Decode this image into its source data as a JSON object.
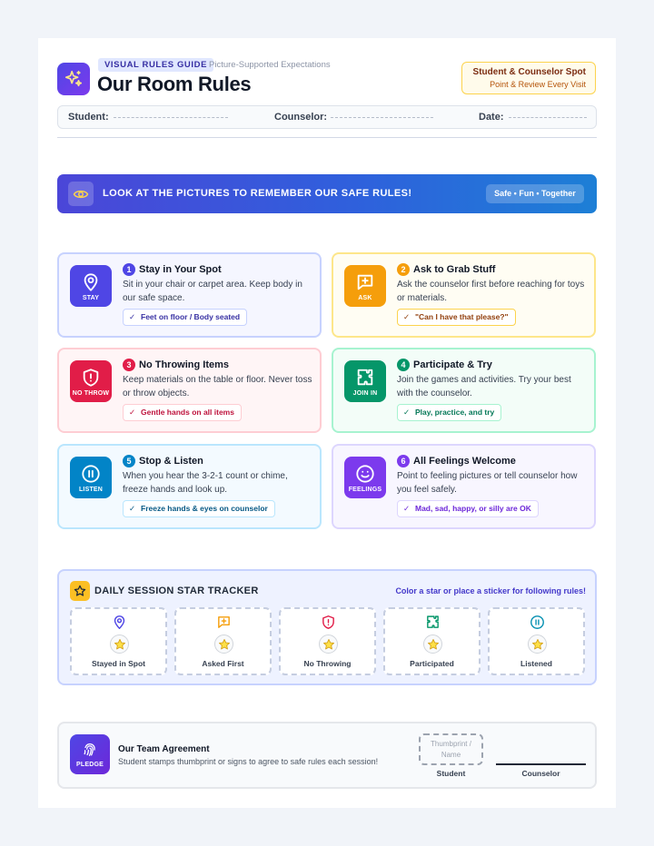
{
  "header": {
    "badge": "VISUAL RULES GUIDE",
    "subtitle": "Picture-Supported Expectations",
    "title": "Our Room Rules",
    "spot_title": "Student & Counselor Spot",
    "spot_subtitle": "Point & Review Every Visit",
    "logo_icon": "sparkles-icon"
  },
  "fields": {
    "student_label": "Student:",
    "counselor_label": "Counselor:",
    "date_label": "Date:"
  },
  "banner": {
    "icon": "eye-icon",
    "text": "LOOK AT THE PICTURES TO REMEMBER OUR SAFE RULES!",
    "tag": "Safe • Fun • Together"
  },
  "rules": [
    {
      "num": "1",
      "title": "Stay in Your Spot",
      "desc": "Sit in your chair or carpet area. Keep body in our safe space.",
      "tip": "Feet on floor / Body seated",
      "tile_label": "STAY",
      "icon": "map-pin-icon",
      "color": "#4f46e5",
      "border": "#c7d2fe",
      "bg": "#f5f6ff",
      "tip_color": "#3730a3",
      "tip_border": "#c7d2fe"
    },
    {
      "num": "2",
      "title": "Ask to Grab Stuff",
      "desc": "Ask the counselor first before reaching for toys or materials.",
      "tip": "\"Can I have that please?\"",
      "tile_label": "ASK",
      "icon": "message-plus-icon",
      "color": "#f59e0b",
      "border": "#fde68a",
      "bg": "#fffdf3",
      "tip_color": "#92400e",
      "tip_border": "#fcd34d"
    },
    {
      "num": "3",
      "title": "No Throwing Items",
      "desc": "Keep materials on the table or floor. Never toss or throw objects.",
      "tip": "Gentle hands on all items",
      "tile_label": "NO THROW",
      "icon": "shield-alert-icon",
      "color": "#e11d48",
      "border": "#fecdd3",
      "bg": "#fff5f6",
      "tip_color": "#be123c",
      "tip_border": "#fecdd3"
    },
    {
      "num": "4",
      "title": "Participate & Try",
      "desc": "Join the games and activities. Try your best with the counselor.",
      "tip": "Play, practice, and try",
      "tile_label": "JOIN IN",
      "icon": "puzzle-icon",
      "color": "#059669",
      "border": "#a7f3d0",
      "bg": "#f3fdf8",
      "tip_color": "#047857",
      "tip_border": "#a7f3d0"
    },
    {
      "num": "5",
      "title": "Stop & Listen",
      "desc": "When you hear the 3-2-1 count or chime, freeze hands and look up.",
      "tip": "Freeze hands & eyes on counselor",
      "tile_label": "LISTEN",
      "icon": "pause-circle-icon",
      "color": "#0284c7",
      "border": "#bae6fd",
      "bg": "#f3faff",
      "tip_color": "#075985",
      "tip_border": "#bae6fd"
    },
    {
      "num": "6",
      "title": "All Feelings Welcome",
      "desc": "Point to feeling pictures or tell counselor how you feel safely.",
      "tip": "Mad, sad, happy, or silly are OK",
      "tile_label": "FEELINGS",
      "icon": "smile-icon",
      "color": "#7c3aed",
      "border": "#ddd6fe",
      "bg": "#f8f6ff",
      "tip_color": "#6d28d9",
      "tip_border": "#ddd6fe"
    }
  ],
  "tracker": {
    "icon": "star-icon",
    "title": "DAILY SESSION STAR TRACKER",
    "note": "Color a star or place a sticker for following rules!",
    "slots": [
      {
        "label": "Stayed in Spot",
        "icon": "map-pin-icon",
        "color": "#4f46e5"
      },
      {
        "label": "Asked First",
        "icon": "message-plus-icon",
        "color": "#f59e0b"
      },
      {
        "label": "No Throwing",
        "icon": "shield-alert-icon",
        "color": "#e11d48"
      },
      {
        "label": "Participated",
        "icon": "puzzle-icon",
        "color": "#059669"
      },
      {
        "label": "Listened",
        "icon": "pause-circle-icon",
        "color": "#0891b2"
      }
    ]
  },
  "agreement": {
    "icon": "fingerprint-icon",
    "tile_label": "PLEDGE",
    "title": "Our Team Agreement",
    "text": "Student stamps thumbprint or signs to agree to safe rules each session!",
    "thumb_placeholder": "Thumbprint / Name",
    "student_label": "Student",
    "counselor_label": "Counselor"
  }
}
